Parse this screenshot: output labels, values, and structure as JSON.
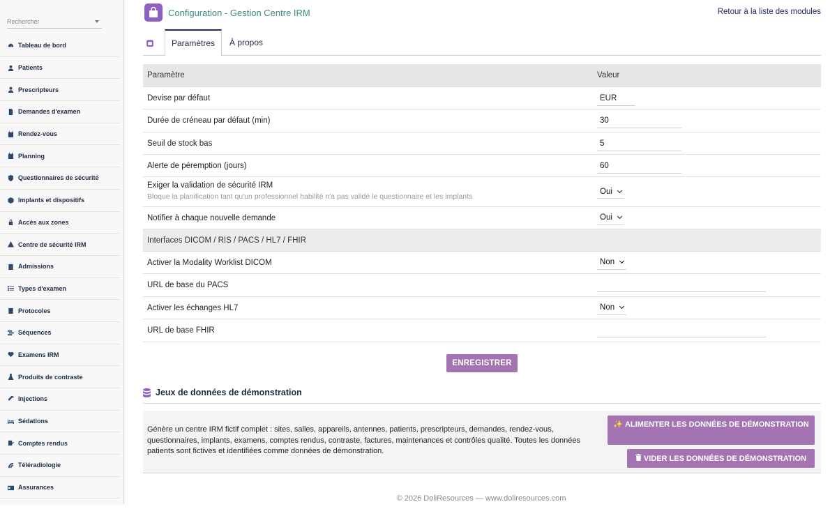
{
  "sidebar": {
    "search_placeholder": "Rechercher",
    "items": [
      {
        "label": "Tableau de bord",
        "icon": "dashboard-icon"
      },
      {
        "label": "Patients",
        "icon": "user-icon"
      },
      {
        "label": "Prescripteurs",
        "icon": "doctor-icon"
      },
      {
        "label": "Demandes d'examen",
        "icon": "document-icon"
      },
      {
        "label": "Rendez-vous",
        "icon": "calendar-icon"
      },
      {
        "label": "Planning",
        "icon": "calendar-check-icon"
      },
      {
        "label": "Questionnaires de sécurité",
        "icon": "shield-icon"
      },
      {
        "label": "Implants et dispositifs",
        "icon": "cube-icon"
      },
      {
        "label": "Accès aux zones",
        "icon": "lock-icon"
      },
      {
        "label": "Centre de sécurité IRM",
        "icon": "warning-icon"
      },
      {
        "label": "Admissions",
        "icon": "clipboard-icon"
      },
      {
        "label": "Types d'examen",
        "icon": "list-icon"
      },
      {
        "label": "Protocoles",
        "icon": "clipboard-list-icon"
      },
      {
        "label": "Séquences",
        "icon": "stream-icon"
      },
      {
        "label": "Examens IRM",
        "icon": "heartbeat-icon"
      },
      {
        "label": "Produits de contraste",
        "icon": "flask-icon"
      },
      {
        "label": "Injections",
        "icon": "syringe-icon"
      },
      {
        "label": "Sédations",
        "icon": "bed-icon"
      },
      {
        "label": "Comptes rendus",
        "icon": "report-icon"
      },
      {
        "label": "Téléradiologie",
        "icon": "satellite-icon"
      },
      {
        "label": "Assurances",
        "icon": "card-icon"
      }
    ]
  },
  "header": {
    "title": "Configuration - Gestion Centre IRM",
    "back_link": "Retour à la liste des modules"
  },
  "tabs": {
    "params": "Paramètres",
    "about": "À propos"
  },
  "table": {
    "head_param": "Paramètre",
    "head_value": "Valeur",
    "rows": {
      "currency": {
        "label": "Devise par défaut",
        "value": "EUR"
      },
      "slot": {
        "label": "Durée de créneau par défaut (min)",
        "value": "30"
      },
      "stock": {
        "label": "Seuil de stock bas",
        "value": "5"
      },
      "expiry": {
        "label": "Alerte de péremption (jours)",
        "value": "60"
      },
      "safety": {
        "label": "Exiger la validation de sécurité IRM",
        "desc": "Bloque la planification tant qu'un professionnel habilité n'a pas validé le questionnaire et les implants",
        "value": "Oui"
      },
      "notify": {
        "label": "Notifier à chaque nouvelle demande",
        "value": "Oui"
      },
      "interfaces_section": "Interfaces DICOM / RIS / PACS / HL7 / FHIR",
      "worklist": {
        "label": "Activer la Modality Worklist DICOM",
        "value": "Non"
      },
      "pacs": {
        "label": "URL de base du PACS",
        "value": ""
      },
      "hl7": {
        "label": "Activer les échanges HL7",
        "value": "Non"
      },
      "fhir": {
        "label": "URL de base FHIR",
        "value": ""
      }
    }
  },
  "save_button": "ENREGISTRER",
  "demo": {
    "title": "Jeux de données de démonstration",
    "text": "Génère un centre IRM fictif complet : sites, salles, appareils, antennes, patients, prescripteurs, demandes, rendez-vous, questionnaires, implants, examens, comptes rendus, contraste, factures, maintenances et contrôles qualité. Toutes les données patients sont fictives et identifiées comme données de démonstration.",
    "feed_button": "ALIMENTER LES DONNÉES DE DÉMONSTRATION",
    "clear_button": "VIDER LES DONNÉES DE DÉMONSTRATION"
  },
  "footer": "© 2026 DoliResources — www.doliresources.com",
  "colors": {
    "accent": "#a374b1",
    "app_icon": "#8f5fc4",
    "title": "#3b8a7d",
    "nav_text": "#1f2a44"
  }
}
